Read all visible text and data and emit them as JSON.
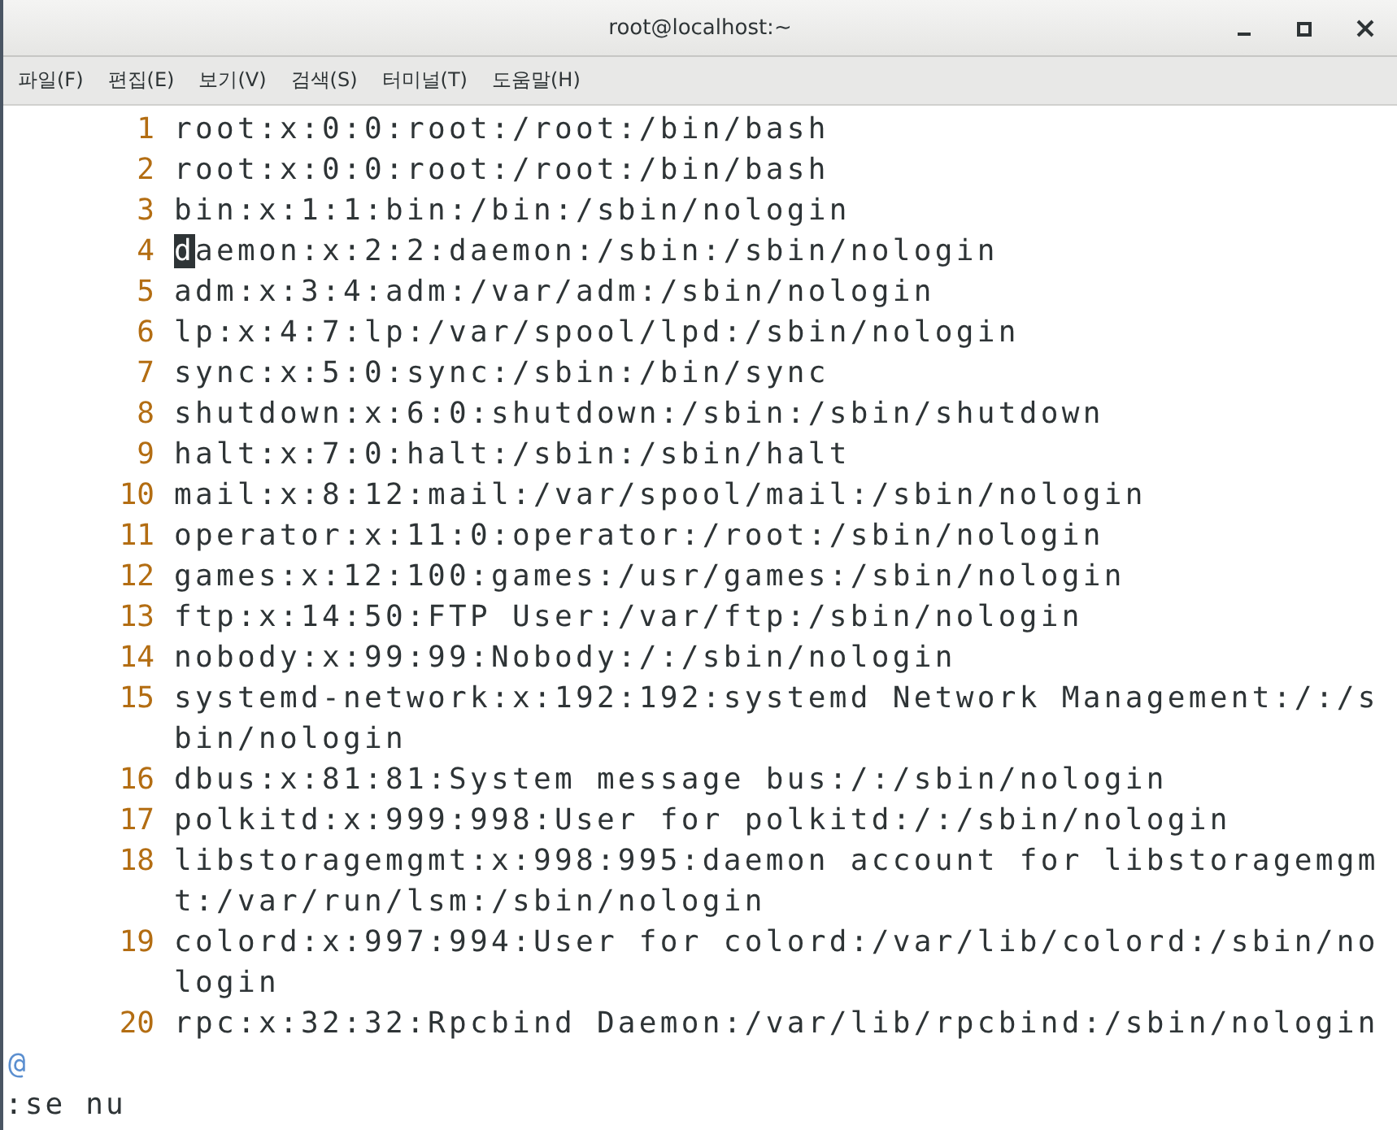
{
  "window": {
    "title": "root@localhost:~"
  },
  "menu": [
    {
      "label": "파일(F)"
    },
    {
      "label": "편집(E)"
    },
    {
      "label": "보기(V)"
    },
    {
      "label": "검색(S)"
    },
    {
      "label": "터미널(T)"
    },
    {
      "label": "도움말(H)"
    }
  ],
  "lines": [
    {
      "number": "1",
      "text": "root:x:0:0:root:/root:/bin/bash",
      "cursor": false
    },
    {
      "number": "2",
      "text": "root:x:0:0:root:/root:/bin/bash",
      "cursor": false
    },
    {
      "number": "3",
      "text": "bin:x:1:1:bin:/bin:/sbin/nologin",
      "cursor": false
    },
    {
      "number": "4",
      "text": "daemon:x:2:2:daemon:/sbin:/sbin/nologin",
      "cursor": true
    },
    {
      "number": "5",
      "text": "adm:x:3:4:adm:/var/adm:/sbin/nologin",
      "cursor": false
    },
    {
      "number": "6",
      "text": "lp:x:4:7:lp:/var/spool/lpd:/sbin/nologin",
      "cursor": false
    },
    {
      "number": "7",
      "text": "sync:x:5:0:sync:/sbin:/bin/sync",
      "cursor": false
    },
    {
      "number": "8",
      "text": "shutdown:x:6:0:shutdown:/sbin:/sbin/shutdown",
      "cursor": false
    },
    {
      "number": "9",
      "text": "halt:x:7:0:halt:/sbin:/sbin/halt",
      "cursor": false
    },
    {
      "number": "10",
      "text": "mail:x:8:12:mail:/var/spool/mail:/sbin/nologin",
      "cursor": false
    },
    {
      "number": "11",
      "text": "operator:x:11:0:operator:/root:/sbin/nologin",
      "cursor": false
    },
    {
      "number": "12",
      "text": "games:x:12:100:games:/usr/games:/sbin/nologin",
      "cursor": false
    },
    {
      "number": "13",
      "text": "ftp:x:14:50:FTP User:/var/ftp:/sbin/nologin",
      "cursor": false
    },
    {
      "number": "14",
      "text": "nobody:x:99:99:Nobody:/:/sbin/nologin",
      "cursor": false
    },
    {
      "number": "15",
      "text": "systemd-network:x:192:192:systemd Network Management:/:/sbin/nologin",
      "cursor": false
    },
    {
      "number": "16",
      "text": "dbus:x:81:81:System message bus:/:/sbin/nologin",
      "cursor": false
    },
    {
      "number": "17",
      "text": "polkitd:x:999:998:User for polkitd:/:/sbin/nologin",
      "cursor": false
    },
    {
      "number": "18",
      "text": "libstoragemgmt:x:998:995:daemon account for libstoragemgmt:/var/run/lsm:/sbin/nologin",
      "cursor": false
    },
    {
      "number": "19",
      "text": "colord:x:997:994:User for colord:/var/lib/colord:/sbin/nologin",
      "cursor": false
    },
    {
      "number": "20",
      "text": "rpc:x:32:32:Rpcbind Daemon:/var/lib/rpcbind:/sbin/nologin",
      "cursor": false
    }
  ],
  "filler": "@",
  "command_line": ":se nu"
}
